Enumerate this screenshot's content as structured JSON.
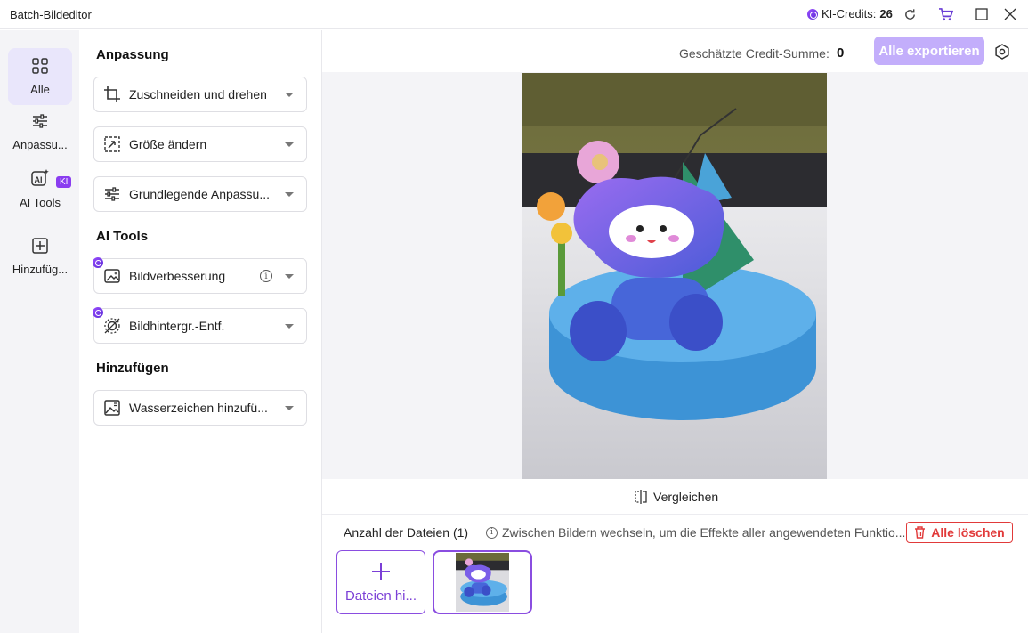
{
  "window": {
    "title": "Batch-Bildeditor",
    "credits_label": "KI-Credits:",
    "credits_value": "26"
  },
  "nav": {
    "items": [
      {
        "label": "Alle",
        "icon": "grid-icon"
      },
      {
        "label": "Anpassu...",
        "icon": "sliders-icon"
      },
      {
        "label": "AI Tools",
        "icon": "ai-icon",
        "badge": "KI"
      },
      {
        "label": "Hinzufüg...",
        "icon": "plus-square-icon"
      }
    ]
  },
  "panel": {
    "sections": {
      "adjust": "Anpassung",
      "ai": "AI Tools",
      "add": "Hinzufügen"
    },
    "tools": {
      "crop": "Zuschneiden und drehen",
      "resize": "Größe ändern",
      "basic": "Grundlegende Anpassu...",
      "enhance": "Bildverbesserung",
      "bg_remove": "Bildhintergr.-Entf.",
      "watermark": "Wasserzeichen hinzufü..."
    }
  },
  "main": {
    "estimate_label": "Geschätzte Credit-Summe:",
    "estimate_value": "0",
    "export_label": "Alle exportieren",
    "compare_label": "Vergleichen",
    "file_count": "Anzahl der Dateien (1)",
    "hint": "Zwischen Bildern wechseln, um die Effekte aller angewendeten Funktio...",
    "delete_label": "Alle löschen",
    "add_files_label": "Dateien hi..."
  },
  "colors": {
    "accent": "#8a4de0",
    "export_bg": "#c3aefb",
    "danger": "#e13a3a",
    "nav_active": "#e9e6fb"
  }
}
